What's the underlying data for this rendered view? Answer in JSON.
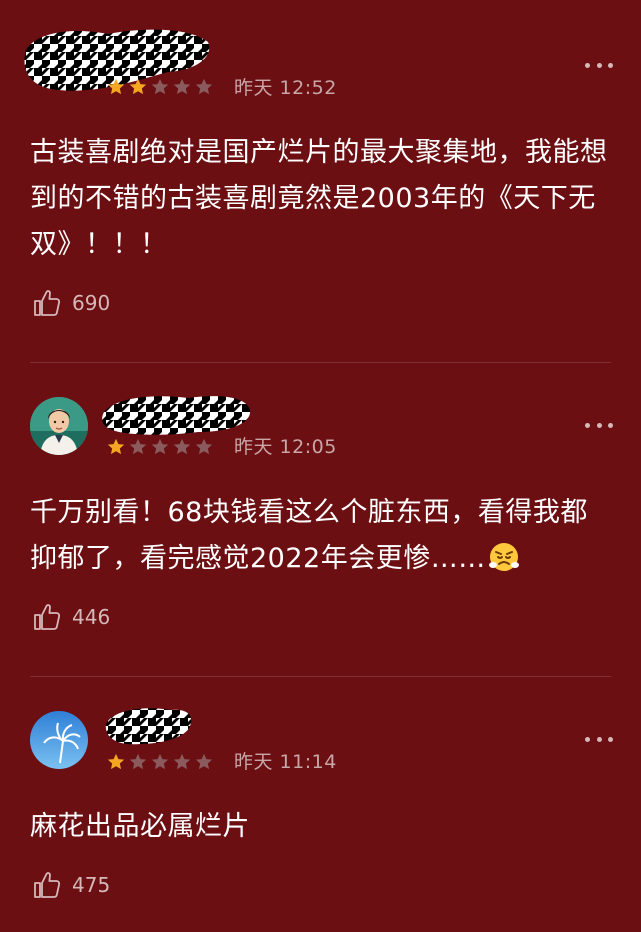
{
  "colors": {
    "background": "#6b0f12",
    "star_filled": "#f5a623",
    "star_empty": "#8a5a5c",
    "meta_text": "#c9a7a8"
  },
  "comments": [
    {
      "rating": 2,
      "max_rating": 5,
      "time": "昨天 12:52",
      "text": "古装喜剧绝对是国产烂片的最大聚集地，我能想到的不错的古装喜剧竟然是2003年的《天下无双》！！！",
      "likes": "690",
      "avatar_icon": "redacted-avatar"
    },
    {
      "rating": 1,
      "max_rating": 5,
      "time": "昨天 12:05",
      "text": "千万别看！68块钱看这么个脏东西，看得我都抑郁了，看完感觉2022年会更惨……",
      "emoji": "angry-face-emoji",
      "likes": "446",
      "avatar_icon": "cartoon-man-avatar"
    },
    {
      "rating": 1,
      "max_rating": 5,
      "time": "昨天 11:14",
      "text": "麻花出品必属烂片",
      "likes": "475",
      "avatar_icon": "palm-tree-avatar"
    }
  ]
}
